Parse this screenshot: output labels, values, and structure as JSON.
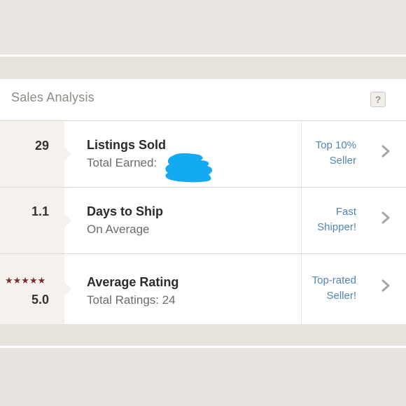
{
  "panel": {
    "title": "Sales Analysis",
    "help_label": "?"
  },
  "rows": [
    {
      "value": "29",
      "title": "Listings Sold",
      "subtitle": "Total Earned:",
      "badge_line1": "Top 10%",
      "badge_line2": "Seller"
    },
    {
      "value": "1.1",
      "title": "Days to Ship",
      "subtitle": "On Average",
      "badge_line1": "Fast",
      "badge_line2": "Shipper!"
    },
    {
      "value": "5.0",
      "stars": "★★★★★",
      "title": "Average Rating",
      "subtitle": "Total Ratings: 24",
      "badge_line1": "Top-rated",
      "badge_line2": "Seller!"
    }
  ],
  "colors": {
    "accent_link": "#4f86b3",
    "star": "#7a2b2f",
    "redaction": "#12aaf0"
  },
  "icons": {
    "help": "question-mark-icon",
    "row_arrow": "chevron-right-icon"
  }
}
